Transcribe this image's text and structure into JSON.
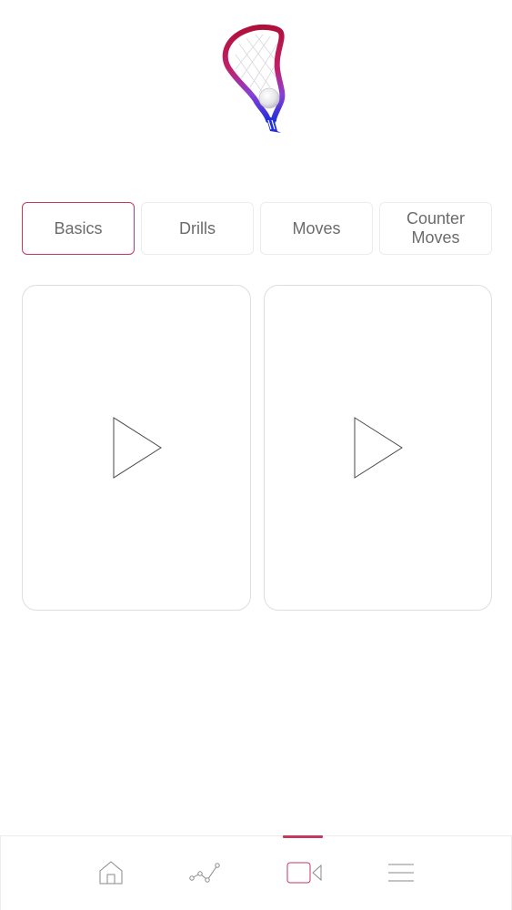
{
  "tabs": [
    {
      "label": "Basics",
      "active": true
    },
    {
      "label": "Drills",
      "active": false
    },
    {
      "label": "Moves",
      "active": false
    },
    {
      "label": "Counter\nMoves",
      "active": false
    }
  ],
  "videos": [
    {
      "icon": "play-icon"
    },
    {
      "icon": "play-icon"
    }
  ],
  "bottom_nav": [
    {
      "icon": "home-icon",
      "active": false
    },
    {
      "icon": "stats-chart-icon",
      "active": false
    },
    {
      "icon": "video-camera-icon",
      "active": true
    },
    {
      "icon": "menu-icon",
      "active": false
    }
  ],
  "colors": {
    "accent": "#c23a5d",
    "border": "#ececec",
    "text": "#6b6b6b",
    "logo_red": "#b0103a",
    "logo_purple": "#8a3fd6",
    "logo_blue": "#2430d8"
  }
}
